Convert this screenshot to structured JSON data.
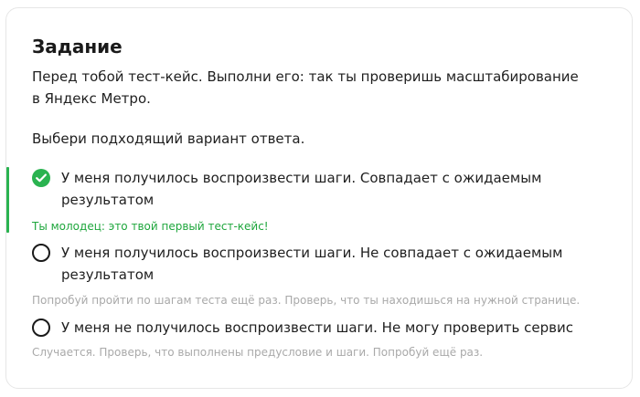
{
  "task": {
    "title": "Задание",
    "intro": "Перед тобой тест-кейс. Выполни его: так ты проверишь масштабирование в Яндекс Метро.",
    "prompt": "Выбери подходящий вариант ответа."
  },
  "options": [
    {
      "label": "У меня получилось воспроизвести шаги. Совпадает с ожидаемым результатом",
      "selected": true,
      "feedback": "Ты молодец: это твой первый тест-кейс!",
      "feedback_type": "success"
    },
    {
      "label": "У меня получилось воспроизвести шаги. Не совпадает с ожидаемым результатом",
      "selected": false,
      "feedback": "Попробуй пройти по шагам теста ещё раз. Проверь, что ты находишься на нужной странице.",
      "feedback_type": "hint"
    },
    {
      "label": "У меня не получилось воспроизвести шаги. Не могу проверить сервис",
      "selected": false,
      "feedback": "Случается. Проверь, что выполнены предусловие и шаги. Попробуй ещё раз.",
      "feedback_type": "hint"
    }
  ],
  "colors": {
    "accent": "#2ab350",
    "success_text": "#1ea63c",
    "hint_text": "#a9a9a9",
    "border": "#e6e6e6"
  },
  "icons": {
    "selected_radio": "check-icon"
  }
}
